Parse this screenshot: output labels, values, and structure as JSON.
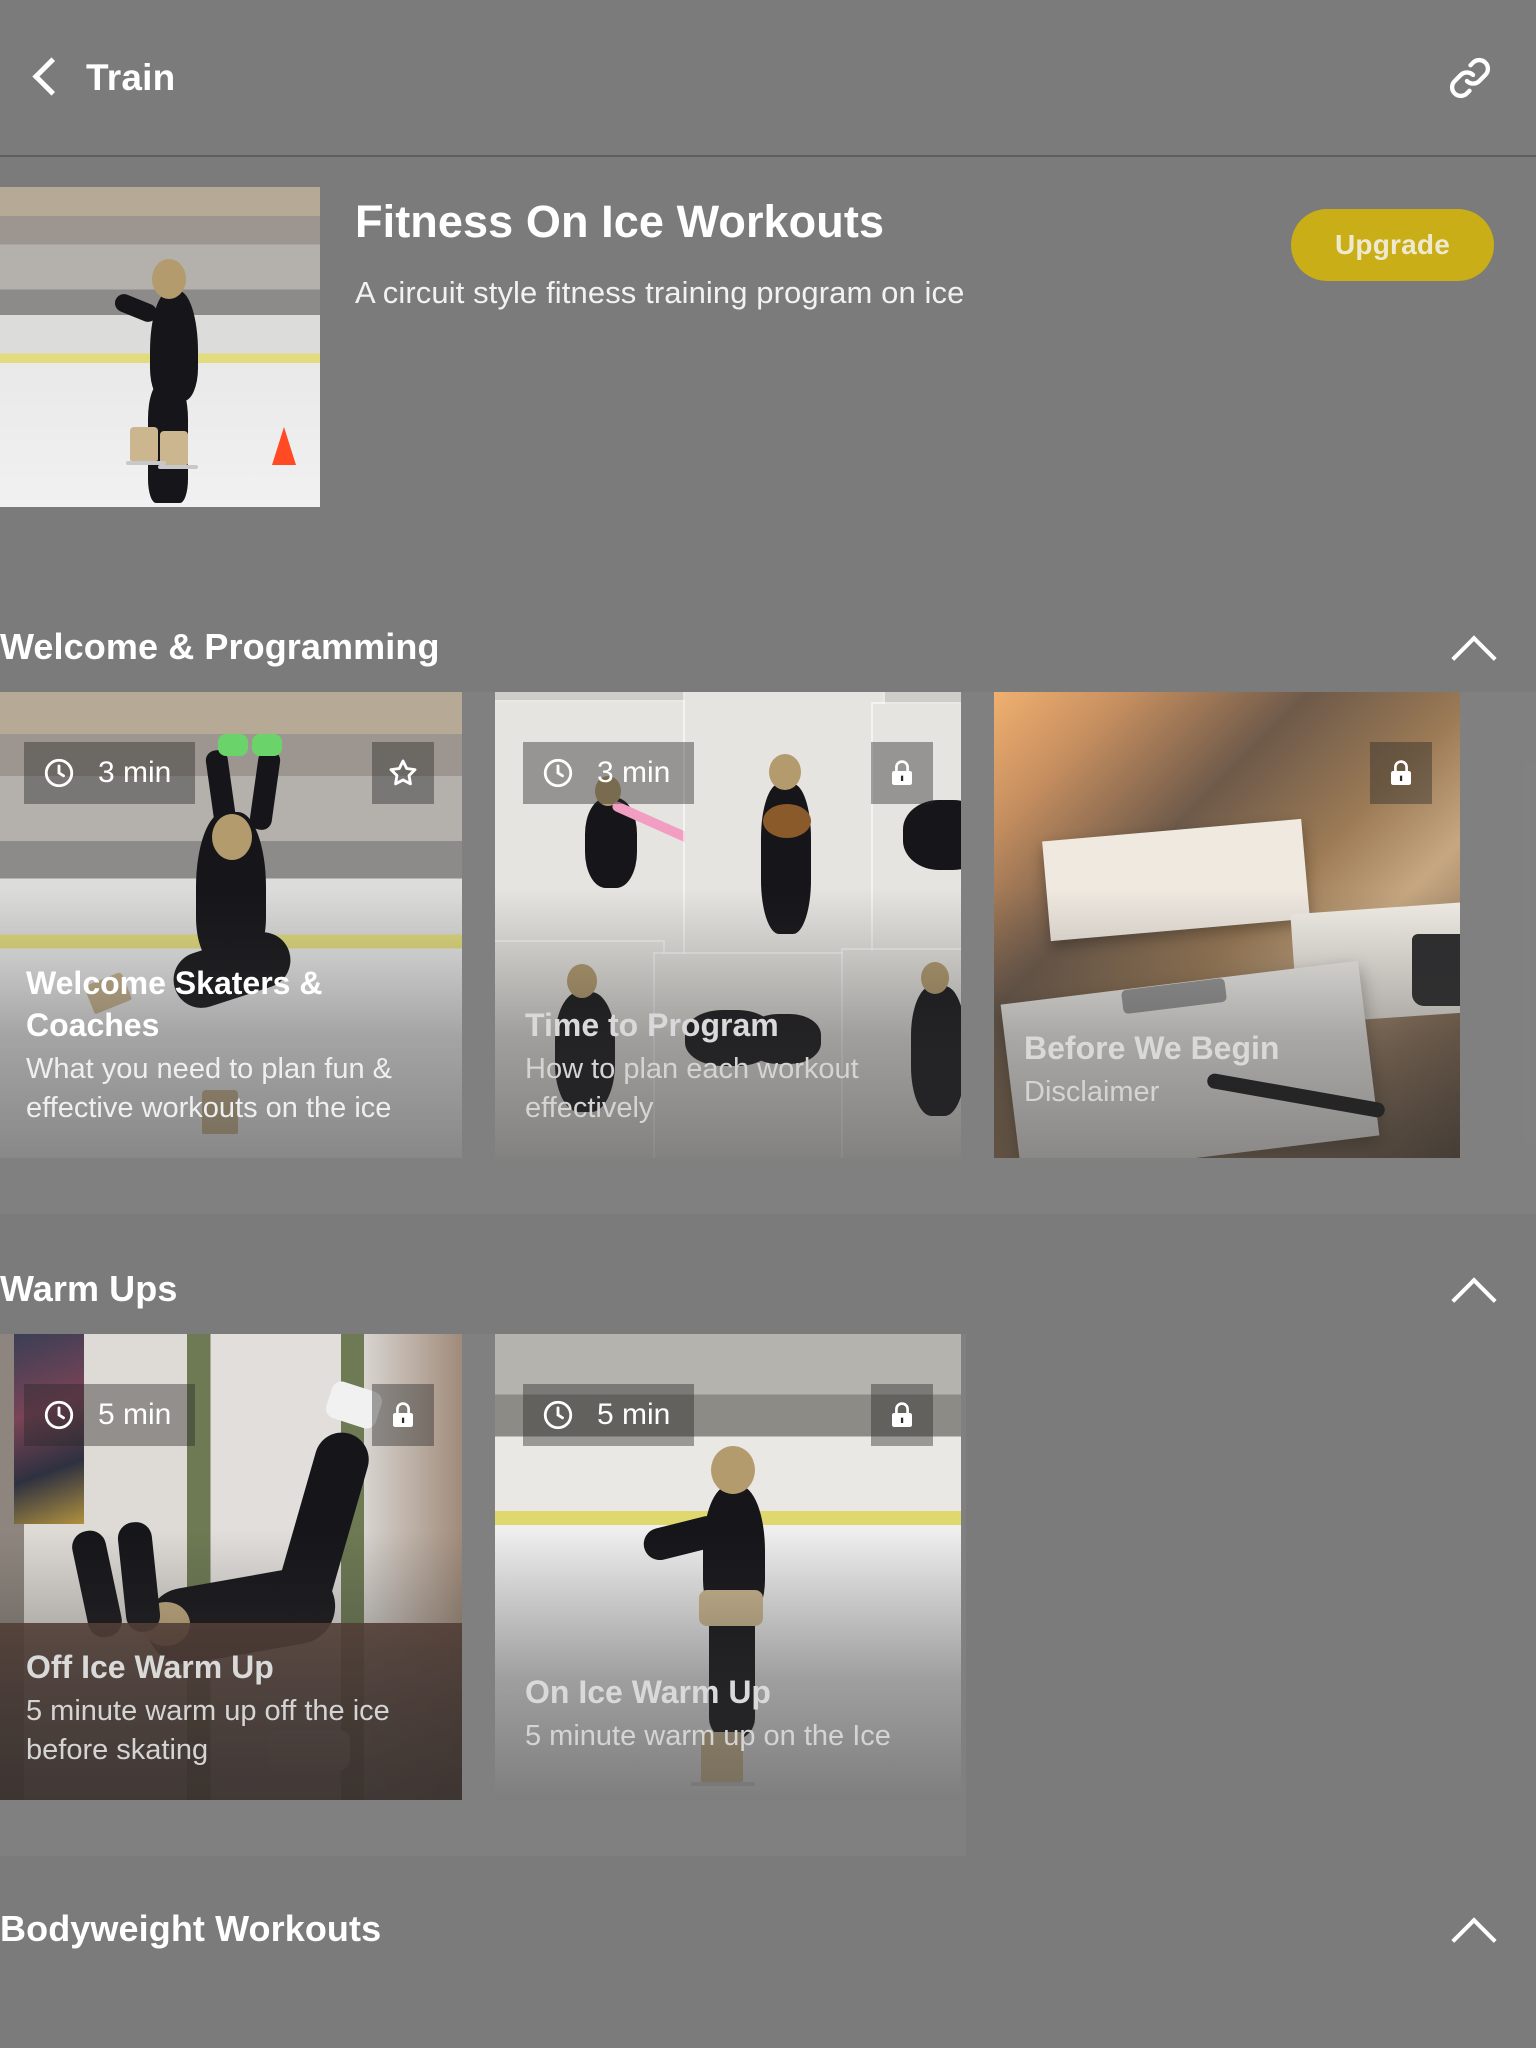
{
  "app": {
    "background_color": "#7b7b7b",
    "accent_color": "#c9ae17"
  },
  "navbar": {
    "back_label": "Train",
    "back_icon": "chevron-left-icon",
    "link_icon": "link-icon"
  },
  "program": {
    "title": "Fitness On Ice Workouts",
    "subtitle": "A circuit style fitness training program on ice",
    "upgrade_label": "Upgrade",
    "thumbnail_alt": "skater-on-ice-thumbnail"
  },
  "sections": [
    {
      "title": "Welcome & Programming",
      "toggle_icon": "chevron-up-icon",
      "expanded": true,
      "cards": [
        {
          "duration": "3 min",
          "duration_icon": "clock-icon",
          "corner_icon": "star-icon",
          "locked": false,
          "title": "Welcome Skaters & Coaches",
          "description": "What you need to plan fun & effective workouts on the ice",
          "art": "art-rink"
        },
        {
          "duration": "3 min",
          "duration_icon": "clock-icon",
          "corner_icon": "lock-icon",
          "locked": true,
          "title": "Time to Program",
          "description": "How to plan each workout effectively",
          "art": "art-collage"
        },
        {
          "duration": "",
          "duration_icon": "",
          "corner_icon": "lock-icon",
          "locked": true,
          "title": "Before We Begin",
          "description": "Disclaimer",
          "art": "art-desk"
        }
      ]
    },
    {
      "title": "Warm Ups",
      "toggle_icon": "chevron-up-icon",
      "expanded": true,
      "cards": [
        {
          "duration": "5 min",
          "duration_icon": "clock-icon",
          "corner_icon": "lock-icon",
          "locked": true,
          "title": "Off Ice Warm Up",
          "description": "5 minute warm up off the ice before skating",
          "art": "art-hall"
        },
        {
          "duration": "5 min",
          "duration_icon": "clock-icon",
          "corner_icon": "lock-icon",
          "locked": true,
          "title": "On Ice Warm Up",
          "description": "5 minute warm up on the Ice",
          "art": "art-ice"
        }
      ]
    },
    {
      "title": "Bodyweight Workouts",
      "toggle_icon": "chevron-up-icon",
      "expanded": true,
      "cards": []
    }
  ]
}
